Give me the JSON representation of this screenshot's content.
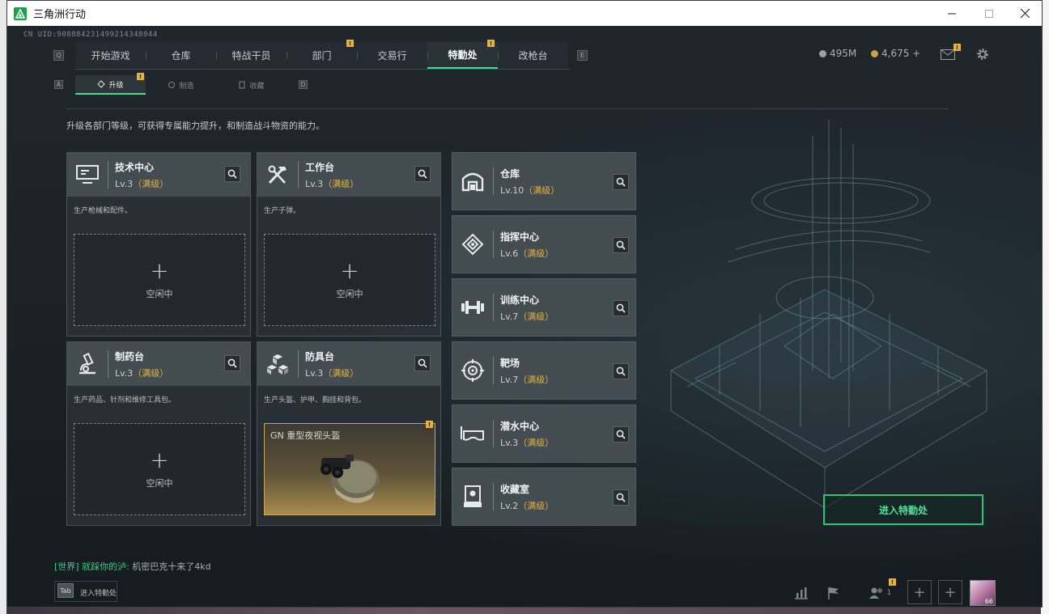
{
  "window": {
    "title": "三角洲行动"
  },
  "uid": "CN UID:908884231499214348044",
  "nav": {
    "left_key": "Q",
    "right_key": "E",
    "tabs": [
      {
        "label": "开始游戏",
        "active": false,
        "badge": ""
      },
      {
        "label": "仓库",
        "active": false,
        "badge": ""
      },
      {
        "label": "特战干员",
        "active": false,
        "badge": ""
      },
      {
        "label": "部门",
        "active": false,
        "badge": "!"
      },
      {
        "label": "交易行",
        "active": false,
        "badge": ""
      },
      {
        "label": "特勤处",
        "active": true,
        "badge": "!"
      },
      {
        "label": "改枪台",
        "active": false,
        "badge": ""
      }
    ]
  },
  "currency": {
    "coins": "495M",
    "gold": "4,675 +"
  },
  "subnav": {
    "left_key": "A",
    "right_key": "D",
    "tabs": [
      {
        "label": "升级",
        "active": true,
        "badge": "!"
      },
      {
        "label": "制造",
        "active": false
      },
      {
        "label": "收藏",
        "active": false
      }
    ]
  },
  "description": "升级各部门等级，可获得专属能力提升，和制造战斗物资的能力。",
  "cards": [
    {
      "name": "技术中心",
      "level": "Lv.3",
      "max": "（满级）",
      "desc": "生产枪械和配件。",
      "state": "空闲中",
      "icon": "monitor-icon"
    },
    {
      "name": "工作台",
      "level": "Lv.3",
      "max": "（满级）",
      "desc": "生产子弹。",
      "state": "空闲中",
      "icon": "tools-icon"
    },
    {
      "name": "制药台",
      "level": "Lv.3",
      "max": "（满级）",
      "desc": "生产药品、针剂和维修工具包。",
      "state": "空闲中",
      "icon": "microscope-icon"
    },
    {
      "name": "防具台",
      "level": "Lv.3",
      "max": "（满级）",
      "desc": "生产头盔、护甲、胸挂和背包。",
      "item": "GN 重型夜视头盔",
      "item_badge": "!",
      "icon": "cubes-icon"
    }
  ],
  "facilities": [
    {
      "name": "仓库",
      "level": "Lv.10",
      "max": "（满级）",
      "icon": "warehouse-icon"
    },
    {
      "name": "指挥中心",
      "level": "Lv.6",
      "max": "（满级）",
      "icon": "command-icon"
    },
    {
      "name": "训练中心",
      "level": "Lv.7",
      "max": "（满级）",
      "icon": "dumbbell-icon"
    },
    {
      "name": "靶场",
      "level": "Lv.7",
      "max": "（满级）",
      "icon": "target-icon"
    },
    {
      "name": "潜水中心",
      "level": "Lv.3",
      "max": "（满级）",
      "icon": "goggles-icon"
    },
    {
      "name": "收藏室",
      "level": "Lv.2",
      "max": "（满级）",
      "icon": "display-case-icon"
    }
  ],
  "enter_button": "进入特勤处",
  "chat": {
    "channel": "[世界] 就踩你的泸:",
    "message": " 机密巴克十来了4kd"
  },
  "bottom": {
    "tab_key": "Tab",
    "tab_label": "进入特勤处",
    "friends_count": "1",
    "badge": "!",
    "level": "66"
  },
  "colors": {
    "accent": "#3ddc97",
    "max_level": "#e3b340",
    "badge": "#e8b23a"
  }
}
